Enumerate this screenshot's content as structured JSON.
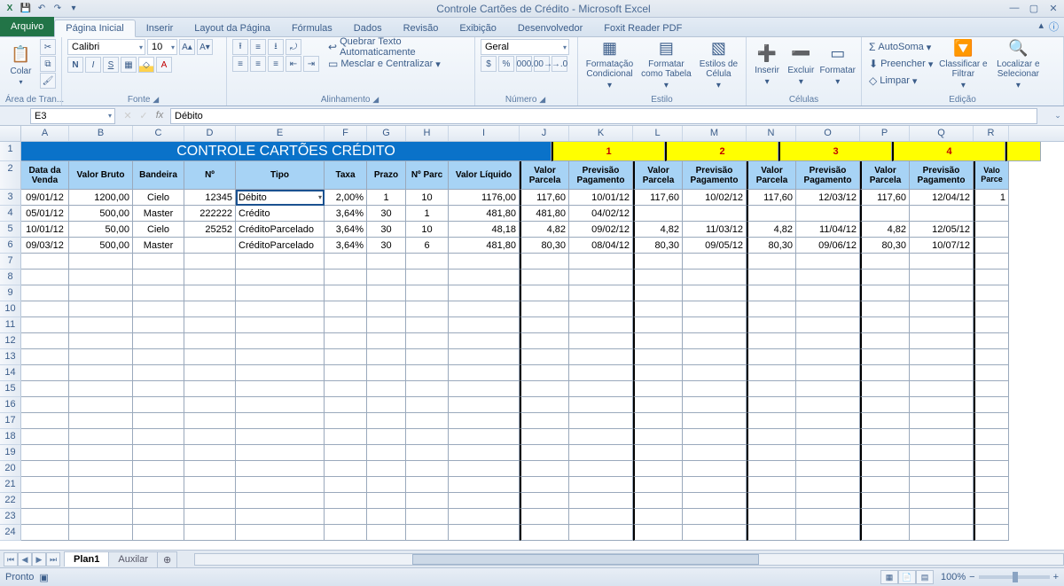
{
  "app": {
    "title": "Controle Cartões de Crédito - Microsoft Excel",
    "qat": [
      "save-icon",
      "undo-icon",
      "redo-icon",
      "qat-more-icon"
    ]
  },
  "tabs": {
    "file": "Arquivo",
    "items": [
      "Página Inicial",
      "Inserir",
      "Layout da Página",
      "Fórmulas",
      "Dados",
      "Revisão",
      "Exibição",
      "Desenvolvedor",
      "Foxit Reader PDF"
    ],
    "active": 0
  },
  "ribbon": {
    "clipboard": {
      "label": "Área de Tran...",
      "paste": "Colar"
    },
    "font": {
      "label": "Fonte",
      "name": "Calibri",
      "size": "10"
    },
    "alignment": {
      "label": "Alinhamento",
      "wrap": "Quebrar Texto Automaticamente",
      "merge": "Mesclar e Centralizar"
    },
    "number": {
      "label": "Número",
      "format": "Geral"
    },
    "styles": {
      "label": "Estilo",
      "cond": "Formatação Condicional",
      "table": "Formatar como Tabela",
      "cell": "Estilos de Célula"
    },
    "cells": {
      "label": "Células",
      "insert": "Inserir",
      "delete": "Excluir",
      "format": "Formatar"
    },
    "editing": {
      "label": "Edição",
      "autosum": "AutoSoma",
      "fill": "Preencher",
      "clear": "Limpar",
      "sort": "Classificar e Filtrar",
      "find": "Localizar e Selecionar"
    }
  },
  "namebox": "E3",
  "formula": "Débito",
  "columns": [
    "A",
    "B",
    "C",
    "D",
    "E",
    "F",
    "G",
    "H",
    "I",
    "J",
    "K",
    "L",
    "M",
    "N",
    "O",
    "P",
    "Q",
    "R"
  ],
  "banner": "CONTROLE CARTÕES CRÉDITO",
  "groupNums": [
    "1",
    "2",
    "3",
    "4"
  ],
  "headers": {
    "data": "Data da Venda",
    "valorbruto": "Valor Bruto",
    "bandeira": "Bandeira",
    "num": "Nº",
    "tipo": "Tipo",
    "taxa": "Taxa",
    "prazo": "Prazo",
    "nparc": "Nº Parc",
    "liquido": "Valor Líquido",
    "vparcela": "Valor Parcela",
    "prevpag": "Previsão Pagamento",
    "valor5": "Valo Parce"
  },
  "rows": [
    {
      "n": "3",
      "data": "09/01/12",
      "vb": "1200,00",
      "band": "Cielo",
      "num": "12345",
      "tipo": "Débito",
      "taxa": "2,00%",
      "prazo": "1",
      "np": "10",
      "liq": "1176,00",
      "j": "117,60",
      "k": "10/01/12",
      "l": "117,60",
      "m": "10/02/12",
      "n2": "117,60",
      "o": "12/03/12",
      "p": "117,60",
      "q": "12/04/12",
      "r": "1"
    },
    {
      "n": "4",
      "data": "05/01/12",
      "vb": "500,00",
      "band": "Master",
      "num": "222222",
      "tipo": "Crédito",
      "taxa": "3,64%",
      "prazo": "30",
      "np": "1",
      "liq": "481,80",
      "j": "481,80",
      "k": "04/02/12",
      "l": "",
      "m": "",
      "n2": "",
      "o": "",
      "p": "",
      "q": "",
      "r": ""
    },
    {
      "n": "5",
      "data": "10/01/12",
      "vb": "50,00",
      "band": "Cielo",
      "num": "25252",
      "tipo": "CréditoParcelado",
      "taxa": "3,64%",
      "prazo": "30",
      "np": "10",
      "liq": "48,18",
      "j": "4,82",
      "k": "09/02/12",
      "l": "4,82",
      "m": "11/03/12",
      "n2": "4,82",
      "o": "11/04/12",
      "p": "4,82",
      "q": "12/05/12",
      "r": ""
    },
    {
      "n": "6",
      "data": "09/03/12",
      "vb": "500,00",
      "band": "Master",
      "num": "",
      "tipo": "CréditoParcelado",
      "taxa": "3,64%",
      "prazo": "30",
      "np": "6",
      "liq": "481,80",
      "j": "80,30",
      "k": "08/04/12",
      "l": "80,30",
      "m": "09/05/12",
      "n2": "80,30",
      "o": "09/06/12",
      "p": "80,30",
      "q": "10/07/12",
      "r": ""
    }
  ],
  "emptyRows": [
    "7",
    "8",
    "9",
    "10",
    "11",
    "12",
    "13",
    "14",
    "15",
    "16",
    "17",
    "18",
    "19",
    "20",
    "21",
    "22",
    "23",
    "24"
  ],
  "sheets": {
    "active": "Plan1",
    "others": [
      "Auxilar"
    ],
    "insert": "⊕"
  },
  "status": {
    "ready": "Pronto",
    "zoom": "100%"
  }
}
